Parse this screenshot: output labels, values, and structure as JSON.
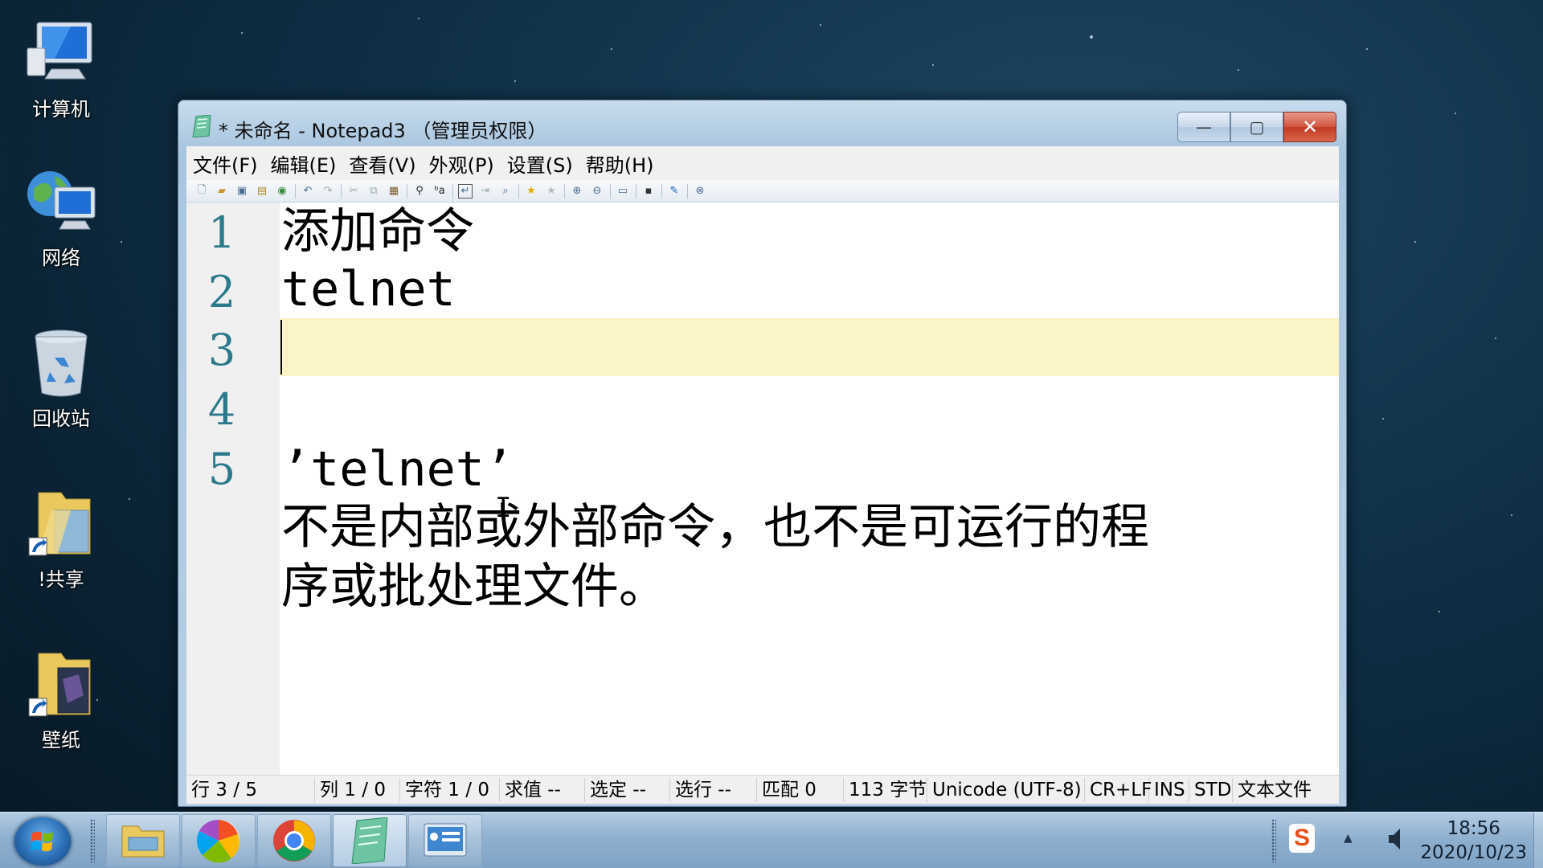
{
  "desktop": {
    "icons": [
      {
        "label": "计算机",
        "icon": "computer-icon"
      },
      {
        "label": "网络",
        "icon": "network-icon"
      },
      {
        "label": "回收站",
        "icon": "recycle-bin-icon"
      },
      {
        "label": "!共享",
        "icon": "shared-folder-shortcut-icon"
      },
      {
        "label": "壁纸",
        "icon": "wallpaper-folder-shortcut-icon"
      }
    ]
  },
  "window": {
    "title": "* 未命名 - Notepad3 （管理员权限）",
    "buttons": {
      "minimize": "—",
      "maximize": "▢",
      "close": "✕"
    },
    "menu": [
      "文件(F)",
      "编辑(E)",
      "查看(V)",
      "外观(P)",
      "设置(S)",
      "帮助(H)"
    ],
    "toolbar_icons": [
      "new-file-icon",
      "open-icon",
      "save-icon",
      "save-as-icon",
      "revert-icon",
      "undo-icon",
      "redo-icon",
      "cut-icon",
      "copy-icon",
      "paste-icon",
      "find-icon",
      "replace-icon",
      "word-wrap-icon",
      "goto-icon",
      "zoom-find-icon",
      "favorite-add-icon",
      "favorite-icon",
      "zoom-in-icon",
      "zoom-out-icon",
      "schema-icon",
      "screen-icon",
      "pin-icon",
      "exit-icon"
    ],
    "editor": {
      "line_numbers": [
        "1",
        "2",
        "3",
        "4",
        "5"
      ],
      "lines": {
        "l1": "添加命令",
        "l2": "telnet",
        "l3": "",
        "l4": "",
        "l5a": "’telnet’",
        "l5b": "不是内部或外部命令，也不是可运行的程",
        "l5c": "序或批处理文件。"
      },
      "current_line": 3
    },
    "status": {
      "line": "行  3 / 5",
      "col": "列  1 / 0",
      "char": "字符  1 / 0",
      "eval": "求值  --",
      "sel": "选定  --",
      "sel_lines": "选行  --",
      "match": "匹配  0",
      "bytes": "113 字节",
      "encoding": "Unicode (UTF-8)",
      "eol": "CR+LF",
      "ins": "INS",
      "std": "STD",
      "type": "文本文件"
    }
  },
  "taskbar": {
    "apps": [
      "file-explorer-icon",
      "photos-pinwheel-icon",
      "chrome-icon",
      "notepad3-icon",
      "control-panel-icon"
    ],
    "tray": {
      "ime": "S",
      "time": "18:56",
      "date": "2020/10/23"
    }
  },
  "colors": {
    "current_line": "#fbf4c6",
    "line_number": "#2b7a8c",
    "gutter": "#f0f0f0"
  }
}
